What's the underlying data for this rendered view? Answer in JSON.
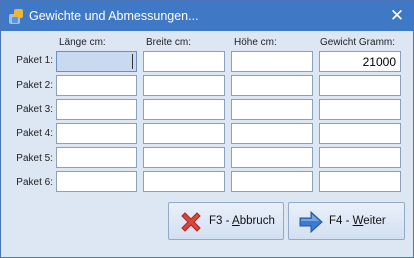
{
  "window": {
    "title": "Gewichte und Abmessungen...",
    "close_glyph": "✕",
    "icon": "app-icon"
  },
  "columns": [
    "Länge cm:",
    "Breite cm:",
    "Höhe cm:",
    "Gewicht Gramm:"
  ],
  "rows": [
    {
      "label": "Paket 1:",
      "values": [
        "",
        "",
        "",
        "21000"
      ]
    },
    {
      "label": "Paket 2:",
      "values": [
        "",
        "",
        "",
        ""
      ]
    },
    {
      "label": "Paket 3:",
      "values": [
        "",
        "",
        "",
        ""
      ]
    },
    {
      "label": "Paket 4:",
      "values": [
        "",
        "",
        "",
        ""
      ]
    },
    {
      "label": "Paket 5:",
      "values": [
        "",
        "",
        "",
        ""
      ]
    },
    {
      "label": "Paket 6:",
      "values": [
        "",
        "",
        "",
        ""
      ]
    }
  ],
  "buttons": {
    "cancel": {
      "prefix": "F3 - ",
      "underline": "A",
      "rest": "bbruch",
      "icon": "red-x-icon",
      "color": "#d9463e"
    },
    "next": {
      "prefix": "F4 - ",
      "underline": "W",
      "rest": "eiter",
      "icon": "arrow-right-icon",
      "color": "#3d7bd0"
    }
  },
  "colors": {
    "titlebar": "#3f78c4",
    "body": "#dde7f4",
    "active_field": "#c8d9f0"
  }
}
